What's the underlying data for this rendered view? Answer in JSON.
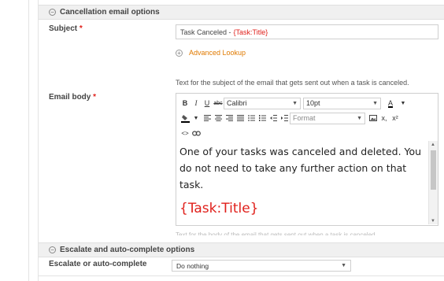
{
  "cancellation_section": {
    "header": "Cancellation email options",
    "subject": {
      "label": "Subject",
      "required_mark": "*",
      "value_text": "Task Canceled -",
      "value_token": "{Task:Title}"
    },
    "advanced_lookup": "Advanced Lookup",
    "help_text": "Text for the subject of the email that gets sent out when a task is canceled.",
    "email_body": {
      "label": "Email body",
      "required_mark": "*",
      "toolbar": {
        "bold": "B",
        "italic": "I",
        "underline": "U",
        "strikethrough": "abc",
        "font_family": "Calibri",
        "font_size": "10pt",
        "font_color": "A",
        "format": "Format",
        "subscript": "x,",
        "superscript": "x²",
        "source": "<>"
      },
      "content_text": "One of your tasks was canceled and deleted. You do not need to take any further action on that task.",
      "content_token": "{Task:Title}",
      "help_text_partial": "Text for the body of the email that gets sent out when a task is canceled."
    }
  },
  "escalate_section": {
    "header": "Escalate and auto-complete options",
    "field": {
      "label": "Escalate or auto-complete",
      "value": "Do nothing"
    }
  }
}
